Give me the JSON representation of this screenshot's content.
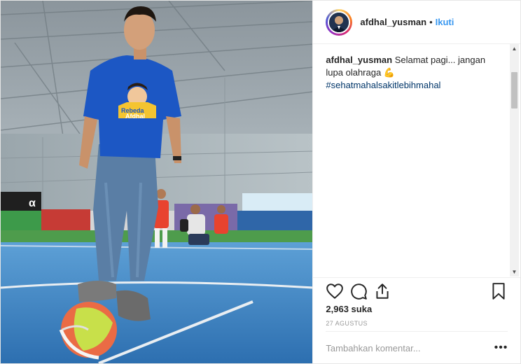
{
  "post": {
    "username": "afdhal_yusman",
    "separator": "•",
    "follow_label": "Ikuti",
    "caption": {
      "username": "afdhal_yusman",
      "text": "Selamat pagi... jangan lupa olahraga",
      "emoji": "💪",
      "hashtag": "#sehatmahalsakitlebihmahal"
    },
    "photo": {
      "shirt_text_line1": "Rebeda",
      "shirt_text_line2": "Afdhal",
      "banner_logo": "α"
    },
    "icons": [
      "heart-icon",
      "comment-icon",
      "share-icon",
      "bookmark-icon"
    ],
    "likes": "2,963 suka",
    "date": "27 AGUSTUS",
    "comment_placeholder": "Tambahkan komentar...",
    "more_label": "•••",
    "scroll_up": "▲",
    "scroll_down": "▼"
  }
}
